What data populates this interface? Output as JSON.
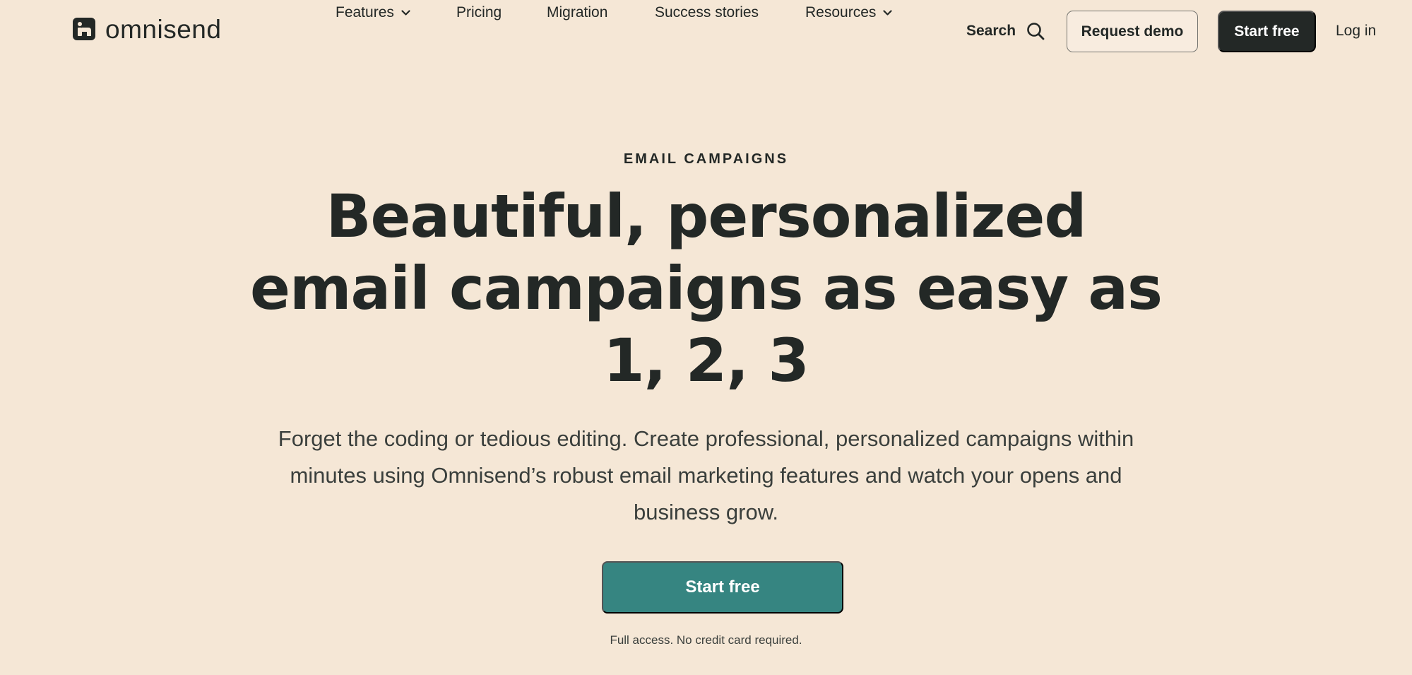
{
  "header": {
    "logo": {
      "name": "omnisend",
      "icon": "omnisend-logo-icon"
    },
    "nav": [
      {
        "label": "Features",
        "has_dropdown": true
      },
      {
        "label": "Pricing",
        "has_dropdown": false
      },
      {
        "label": "Migration",
        "has_dropdown": false
      },
      {
        "label": "Success stories",
        "has_dropdown": false
      },
      {
        "label": "Resources",
        "has_dropdown": true
      }
    ],
    "search": {
      "label": "Search",
      "icon": "search-icon"
    },
    "request_demo_label": "Request demo",
    "start_free_label": "Start free",
    "login_label": "Log in"
  },
  "hero": {
    "eyebrow": "EMAIL CAMPAIGNS",
    "headline_lines": [
      "Beautiful, personalized",
      "email campaigns as easy as",
      "1, 2, 3"
    ],
    "subcopy_lines": [
      "Forget the coding or tedious editing. Create professional, personalized campaigns within",
      "minutes using Omnisend’s robust email marketing features and watch your opens and",
      "business grow."
    ],
    "cta_label": "Start free",
    "cta_note": "Full access. No credit card required."
  },
  "colors": {
    "background": "#f5e7d6",
    "text": "#232826",
    "dark_button": "#232826",
    "cta": "#368581"
  }
}
